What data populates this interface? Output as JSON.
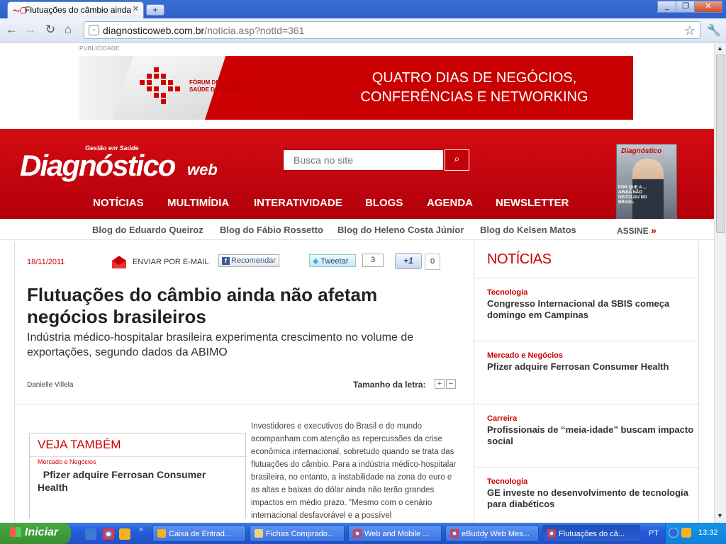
{
  "browser": {
    "tab_title": "Flutuações do câmbio ainda nã",
    "url_domain": "diagnosticoweb.com.br",
    "url_path": "/noticia.asp?notId=361",
    "window_buttons": [
      "_",
      "❐",
      "✕"
    ]
  },
  "ad": {
    "label": "PUBLICIDADE",
    "forum_text": "Fórum de Líderes da Saúde do Nordeste",
    "headline_line1": "QUATRO DIAS DE NEGÓCIOS,",
    "headline_line2": "CONFERÊNCIAS E NETWORKING"
  },
  "site": {
    "logo_sub": "Gestão em Saúde",
    "logo_main": "Diagnóstico",
    "logo_web": "web",
    "search_placeholder": "Busca no site",
    "nav": [
      "NOTÍCIAS",
      "MULTIMÍDIA",
      "INTERATIVIDADE",
      "BLOGS",
      "AGENDA",
      "NEWSLETTER"
    ],
    "blogs": [
      "Blog do Eduardo Queiroz",
      "Blog do Fábio Rossetto",
      "Blog do Heleno Costa Júnior",
      "Blog do Kelsen Matos"
    ],
    "subscribe": "ASSINE",
    "magazine_title": "Diagnóstico",
    "magazine_cover_text": "POR QUE A ... AINDA NÃO DECOLOU NO BRASIL"
  },
  "article": {
    "date": "18/11/2011",
    "email_label": "ENVIAR POR E-MAIL",
    "fb_label": "Recomendar",
    "tweet_label": "Tweetar",
    "tweet_count": "3",
    "gplus_label": "+1",
    "gplus_count": "0",
    "headline": "Flutuações do câmbio ainda não afetam negócios brasileiros",
    "subtitle": "Indústria médico-hospitalar brasileira experimenta crescimento no volume de exportações, segundo dados da ABIMO",
    "author": "Danielle Villela",
    "font_size_label": "Tamanho da letra:",
    "font_plus": "+",
    "font_minus": "−",
    "body": "Investidores e executivos do Brasil e do mundo acompanham com atenção as repercussões da crise econômica internacional, sobretudo quando se trata das flutuações do câmbio. Para a indústria médico-hospitalar brasileira, no entanto, a instabilidade na zona do euro e as altas e baixas do dólar ainda não terão grandes impactos em médio prazo. \"Mesmo com o cenário internacional desfavorável e a possível"
  },
  "see_also": {
    "title": "VEJA TAMBÉM",
    "category": "Mercado e Negócios",
    "link": "Pfizer adquire Ferrosan Consumer Health"
  },
  "sidebar": {
    "title": "NOTÍCIAS",
    "items": [
      {
        "category": "Tecnologia",
        "title": "Congresso Internacional da SBIS começa domingo em Campinas"
      },
      {
        "category": "Mercado e Negócios",
        "title": "Pfizer adquire Ferrosan Consumer Health"
      },
      {
        "category": "Carreira",
        "title": "Profissionais de “meia-idade” buscam impacto social"
      },
      {
        "category": "Tecnologia",
        "title": "GE investe no desenvolvimento de tecnologia para diabéticos"
      }
    ]
  },
  "taskbar": {
    "start_label": "Iniciar",
    "tasks": [
      "Caixa de Entrad...",
      "Fichas Comprado...",
      "Web and Mobile ...",
      "eBuddy Web Mes...",
      "Flutuações do câ..."
    ],
    "lang": "PT",
    "clock": "13:32"
  },
  "colors": {
    "brand_red": "#c8000c",
    "taskbar_blue": "#245ddb"
  }
}
